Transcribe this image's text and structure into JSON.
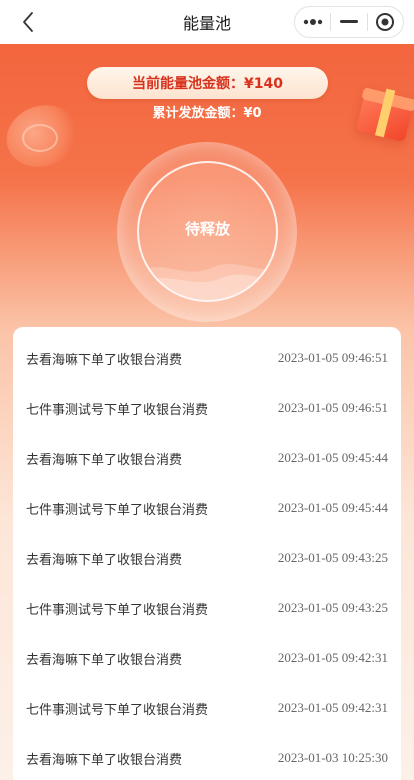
{
  "navbar": {
    "title": "能量池",
    "back_icon": "chevron-left-icon",
    "capsule": {
      "more_icon": "more-dots-icon",
      "minimize_icon": "minimize-icon",
      "close_icon": "target-close-icon"
    }
  },
  "pool": {
    "current_label": "当前能量池金额：¥140",
    "released_label": "累计发放金额：¥0",
    "status": "待释放"
  },
  "records": [
    {
      "desc": "去看海嘛下单了收银台消费",
      "time": "2023-01-05 09:46:51"
    },
    {
      "desc": "七件事测试号下单了收银台消费",
      "time": "2023-01-05 09:46:51"
    },
    {
      "desc": "去看海嘛下单了收银台消费",
      "time": "2023-01-05 09:45:44"
    },
    {
      "desc": "七件事测试号下单了收银台消费",
      "time": "2023-01-05 09:45:44"
    },
    {
      "desc": "去看海嘛下单了收银台消费",
      "time": "2023-01-05 09:43:25"
    },
    {
      "desc": "七件事测试号下单了收银台消费",
      "time": "2023-01-05 09:43:25"
    },
    {
      "desc": "去看海嘛下单了收银台消费",
      "time": "2023-01-05 09:42:31"
    },
    {
      "desc": "七件事测试号下单了收银台消费",
      "time": "2023-01-05 09:42:31"
    },
    {
      "desc": "去看海嘛下单了收银台消费",
      "time": "2023-01-03 10:25:30"
    }
  ],
  "colors": {
    "accent": "#f2613a",
    "pill_text": "#d8321e"
  }
}
